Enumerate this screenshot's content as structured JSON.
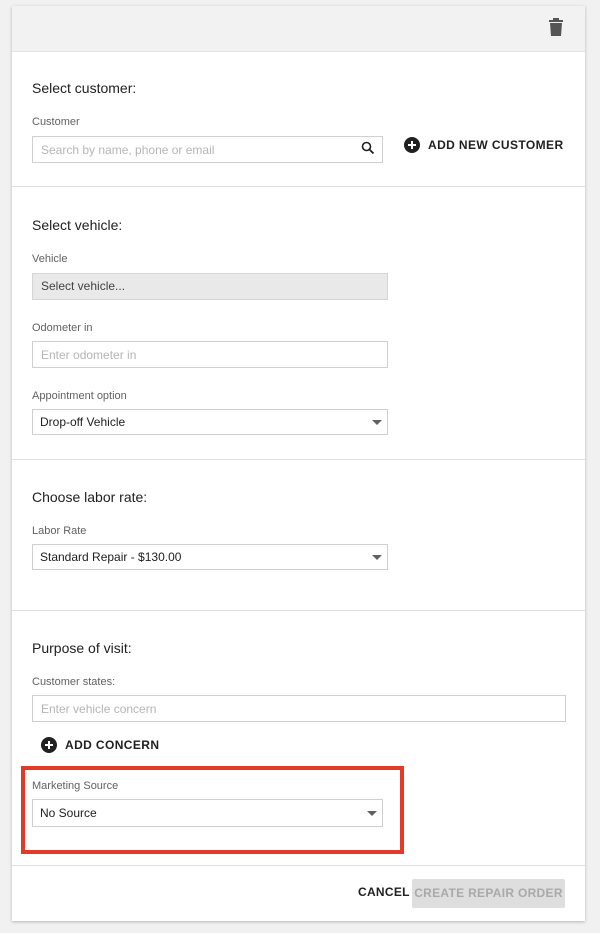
{
  "customer_section": {
    "title": "Select customer:",
    "field_label": "Customer",
    "search_placeholder": "Search by name, phone or email",
    "add_new_label": "ADD NEW CUSTOMER"
  },
  "vehicle_section": {
    "title": "Select vehicle:",
    "vehicle_label": "Vehicle",
    "vehicle_value": "Select vehicle...",
    "odometer_label": "Odometer in",
    "odometer_placeholder": "Enter odometer in",
    "appointment_label": "Appointment option",
    "appointment_value": "Drop-off Vehicle"
  },
  "labor_section": {
    "title": "Choose labor rate:",
    "rate_label": "Labor Rate",
    "rate_value": "Standard Repair - $130.00"
  },
  "purpose_section": {
    "title": "Purpose of visit:",
    "concern_label": "Customer states:",
    "concern_placeholder": "Enter vehicle concern",
    "add_concern_label": "ADD CONCERN",
    "marketing_label": "Marketing Source",
    "marketing_value": "No Source"
  },
  "footer": {
    "cancel_label": "CANCEL",
    "create_label": "CREATE REPAIR ORDER"
  },
  "icons": {
    "delete": "trash-icon",
    "search": "search-icon",
    "add": "plus-circle-icon",
    "dropdown": "caret-down-icon"
  },
  "colors": {
    "highlight": "#e33a27",
    "disabled_button": "#dedede"
  }
}
